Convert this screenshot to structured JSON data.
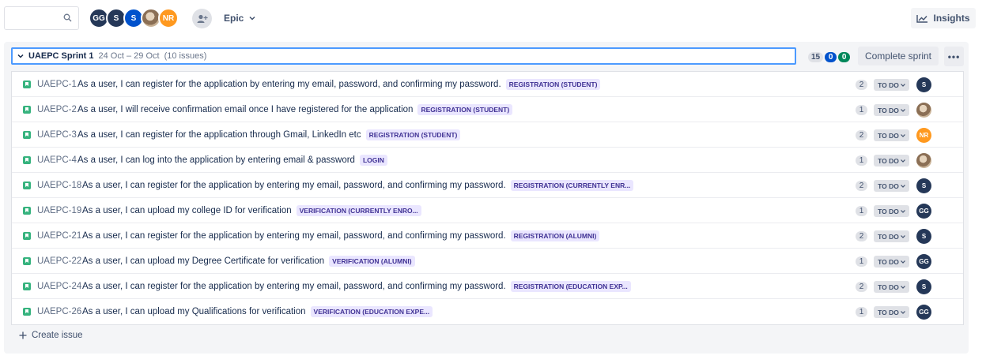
{
  "toolbar": {
    "search_placeholder": "",
    "avatars": [
      {
        "initials": "GG",
        "kind": "gg"
      },
      {
        "initials": "S",
        "kind": "s1"
      },
      {
        "initials": "S",
        "kind": "s2"
      },
      {
        "initials": "",
        "kind": "photo"
      },
      {
        "initials": "NR",
        "kind": "nr"
      }
    ],
    "epic_label": "Epic",
    "insights_label": "Insights"
  },
  "sprint": {
    "name": "UAEPC Sprint 1",
    "dates": "24 Oct – 29 Oct",
    "issue_count": "(10 issues)",
    "count_todo": "15",
    "count_in_progress": "0",
    "count_done": "0",
    "complete_label": "Complete sprint",
    "more_label": "•••",
    "create_label": "Create issue",
    "colors": {
      "todo": "#dfe1e6",
      "in_progress": "#0052cc",
      "done": "#00875a",
      "story": "#36b37e",
      "epic_bg": "#eae6ff",
      "epic_text": "#403294"
    }
  },
  "issues": [
    {
      "key": "UAEPC-1",
      "summary": "As a user, I can register for the application by entering my email, password, and confirming my password.",
      "epic": "REGISTRATION (STUDENT)",
      "points": "2",
      "status": "TO DO",
      "assignee": "S",
      "assignee_kind": "s"
    },
    {
      "key": "UAEPC-2",
      "summary": "As a user, I will receive confirmation email once I have registered for the application",
      "epic": "REGISTRATION (STUDENT)",
      "points": "1",
      "status": "TO DO",
      "assignee": "",
      "assignee_kind": "photo"
    },
    {
      "key": "UAEPC-3",
      "summary": "As a user, I can register for the application through Gmail, LinkedIn etc",
      "epic": "REGISTRATION (STUDENT)",
      "points": "2",
      "status": "TO DO",
      "assignee": "NR",
      "assignee_kind": "nr"
    },
    {
      "key": "UAEPC-4",
      "summary": "As a user, I can log into the application by entering email & password",
      "epic": "LOGIN",
      "points": "1",
      "status": "TO DO",
      "assignee": "",
      "assignee_kind": "photo"
    },
    {
      "key": "UAEPC-18",
      "summary": "As a user, I can register for the application by entering my email, password, and confirming my password.",
      "epic": "REGISTRATION (CURRENTLY ENR...",
      "points": "2",
      "status": "TO DO",
      "assignee": "S",
      "assignee_kind": "s"
    },
    {
      "key": "UAEPC-19",
      "summary": "As a user, I can upload my college ID for verification",
      "epic": "VERIFICATION (CURRENTLY ENRO...",
      "points": "1",
      "status": "TO DO",
      "assignee": "GG",
      "assignee_kind": "gg"
    },
    {
      "key": "UAEPC-21",
      "summary": "As a user, I can register for the application by entering my email, password, and confirming my password.",
      "epic": "REGISTRATION (ALUMNI)",
      "points": "2",
      "status": "TO DO",
      "assignee": "S",
      "assignee_kind": "s"
    },
    {
      "key": "UAEPC-22",
      "summary": "As a user, I can upload my Degree Certificate for verification",
      "epic": "VERIFICATION (ALUMNI)",
      "points": "1",
      "status": "TO DO",
      "assignee": "GG",
      "assignee_kind": "gg"
    },
    {
      "key": "UAEPC-24",
      "summary": "As a user, I can register for the application by entering my email, password, and confirming my password.",
      "epic": "REGISTRATION (EDUCATION EXP...",
      "points": "2",
      "status": "TO DO",
      "assignee": "S",
      "assignee_kind": "s"
    },
    {
      "key": "UAEPC-26",
      "summary": "As a user, I can upload my Qualifications for verification",
      "epic": "VERIFICATION (EDUCATION EXPE...",
      "points": "1",
      "status": "TO DO",
      "assignee": "GG",
      "assignee_kind": "gg"
    }
  ]
}
